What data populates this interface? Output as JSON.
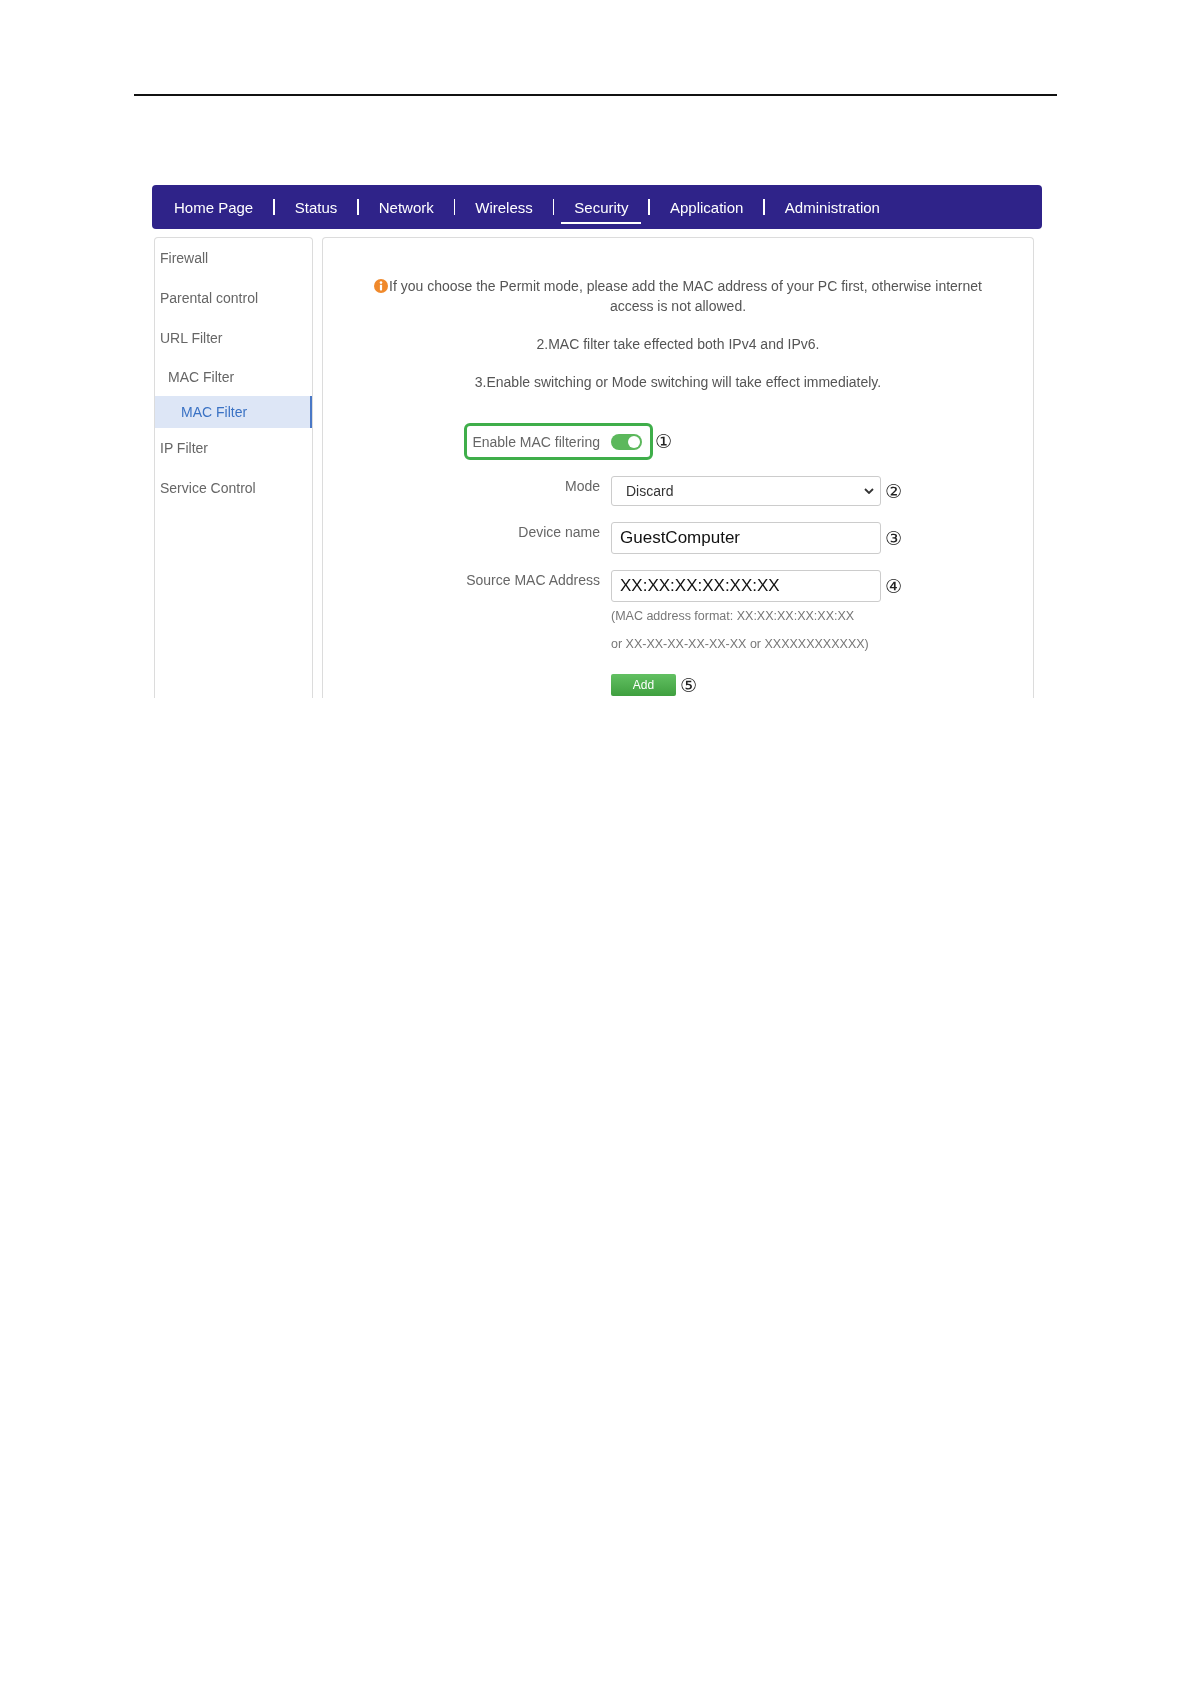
{
  "nav": {
    "tabs": [
      {
        "label": "Home Page",
        "selected": false
      },
      {
        "label": "Status",
        "selected": false
      },
      {
        "label": "Network",
        "selected": false
      },
      {
        "label": "Wireless",
        "selected": false
      },
      {
        "label": "Security",
        "selected": true
      },
      {
        "label": "Application",
        "selected": false
      },
      {
        "label": "Administration",
        "selected": false
      }
    ]
  },
  "sidebar": {
    "items": [
      {
        "label": "Firewall",
        "selected": false
      },
      {
        "label": "Parental control",
        "selected": false
      },
      {
        "label": "URL Filter",
        "selected": false
      },
      {
        "label": "MAC Filter",
        "selected": false,
        "children": [
          {
            "label": "MAC Filter",
            "selected": true
          }
        ]
      },
      {
        "label": "IP Filter",
        "selected": false
      },
      {
        "label": "Service Control",
        "selected": false
      }
    ]
  },
  "notice": {
    "lines": [
      {
        "kind": "warning",
        "text": "If you choose the Permit mode, please add the MAC address of your PC first, otherwise internet access is not allowed."
      },
      {
        "kind": "plain",
        "text": "2.MAC filter take effected both IPv4 and IPv6."
      },
      {
        "kind": "plain",
        "text": "3.Enable switching or Mode switching will take effect immediately."
      }
    ]
  },
  "form": {
    "fields": [
      {
        "kind": "toggle",
        "label": "Enable MAC filtering",
        "on": true,
        "highlighted": true,
        "callout": "①"
      },
      {
        "kind": "select",
        "label": "Mode",
        "value": "Discard",
        "callout": "②"
      },
      {
        "kind": "text",
        "label": "Device name",
        "value": "GuestComputer",
        "callout": "③"
      },
      {
        "kind": "text",
        "label": "Source MAC Address",
        "value": "XX:XX:XX:XX:XX:XX",
        "callout": "④",
        "hint": [
          "(MAC address format: XX:XX:XX:XX:XX:XX",
          "or XX-XX-XX-XX-XX-XX or XXXXXXXXXXXX)"
        ]
      }
    ],
    "add_button": {
      "label": "Add",
      "callout": "⑤"
    }
  }
}
